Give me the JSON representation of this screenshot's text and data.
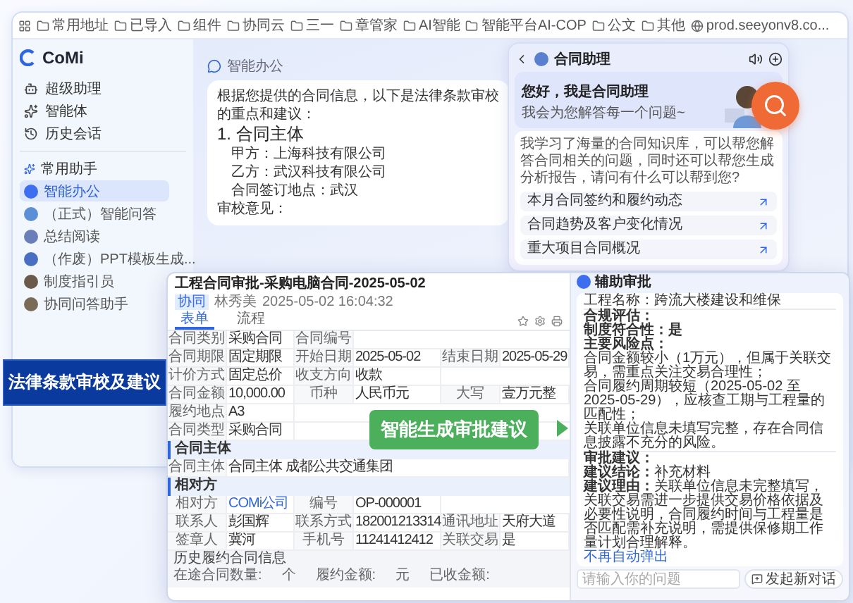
{
  "browser": {
    "bookmarks": [
      {
        "kind": "folder",
        "label": "常用地址"
      },
      {
        "kind": "folder",
        "label": "已导入"
      },
      {
        "kind": "folder",
        "label": "组件"
      },
      {
        "kind": "folder",
        "label": "协同云"
      },
      {
        "kind": "folder",
        "label": "三一"
      },
      {
        "kind": "folder",
        "label": "章管家"
      },
      {
        "kind": "folder",
        "label": "AI智能"
      },
      {
        "kind": "folder",
        "label": "智能平台AI-COP"
      },
      {
        "kind": "folder",
        "label": "公文"
      },
      {
        "kind": "folder",
        "label": "其他"
      },
      {
        "kind": "site",
        "label": "prod.seeyonv8.co..."
      }
    ]
  },
  "sidebar": {
    "logo": "CoMi",
    "nav": [
      {
        "kind": "assistant",
        "label": "超级助理"
      },
      {
        "kind": "agent",
        "label": "智能体"
      },
      {
        "kind": "history",
        "label": "历史会话"
      }
    ],
    "section": "常用助手",
    "assistants": [
      {
        "label": "智能办公",
        "selected": true,
        "color": "#3d6ef0"
      },
      {
        "label": "（正式）智能问答",
        "selected": false,
        "color": "#5b8fd6"
      },
      {
        "label": "总结阅读",
        "selected": false,
        "color": "#6a7fb8"
      },
      {
        "label": "（作废）PPT模板生成...",
        "selected": false,
        "color": "#4a6fc2"
      },
      {
        "label": "制度指引员",
        "selected": false,
        "color": "#6b5a4a"
      },
      {
        "label": "协同问答助手",
        "selected": false,
        "color": "#7a6a58"
      }
    ]
  },
  "chat": {
    "sender": "智能办公",
    "intro": "根据您提供的合同信息，以下是法律条款审校的重点和建议：",
    "heading": "1. 合同主体",
    "lines": [
      "甲方：上海科技有限公司",
      "乙方：武汉科技有限公司",
      "合同签订地点：武汉"
    ],
    "opinion": "审校意见："
  },
  "assistant_panel": {
    "title": "合同助理",
    "greeting": "您好，我是合同助理",
    "subtitle": "我会为您解答每一个问题~",
    "intro": "我学习了海量的合同知识库，可以帮您解答合同相关的问题，同时还可以帮您生成分析报告，请问有什么可以帮到您?",
    "suggestions": [
      "本月合同签约和履约动态",
      "合同趋势及客户变化情况",
      "重大项目合同概况"
    ]
  },
  "form": {
    "title": "工程合同审批-采购电脑合同-2025-05-02",
    "tag": "协同",
    "author": "林秀美",
    "time": "2025-05-02 16:04:32",
    "tabs": [
      {
        "label": "表单",
        "selected": true
      },
      {
        "label": "流程",
        "selected": false
      }
    ],
    "rows": [
      {
        "kind": "fields",
        "cells": [
          {
            "label": "合同类别",
            "value": "采购合同"
          },
          {
            "label": "合同编号"
          }
        ]
      },
      {
        "kind": "fields",
        "cells": [
          {
            "label": "合同期限",
            "value": "固定期限"
          },
          {
            "label": "开始日期",
            "value": "2025-05-02"
          },
          {
            "label": "结束日期",
            "value": "2025-05-29"
          }
        ]
      },
      {
        "kind": "fields",
        "cells": [
          {
            "label": "计价方式",
            "value": "固定总价"
          },
          {
            "label": "收支方向",
            "value": "收款"
          }
        ]
      },
      {
        "kind": "fields",
        "cells": [
          {
            "label": "合同金额",
            "value": "10,000.00"
          },
          {
            "label": "币种",
            "value": "人民币元"
          },
          {
            "label": "大写",
            "value": "壹万元整"
          }
        ]
      },
      {
        "kind": "fields",
        "cells": [
          {
            "label": "履约地点",
            "value": "A3"
          }
        ]
      },
      {
        "kind": "fields",
        "cells": [
          {
            "label": "合同类型",
            "value": "采购合同"
          }
        ]
      },
      {
        "kind": "section",
        "title": "合同主体"
      },
      {
        "kind": "fields",
        "cells": [
          {
            "label": "合同主体",
            "value": "合同主体  成都公共交通集团",
            "wide": true
          }
        ]
      },
      {
        "kind": "section",
        "title": "相对方"
      },
      {
        "kind": "fields",
        "cells": [
          {
            "label": "相对方",
            "value": "COMi公司",
            "link": true
          },
          {
            "label": "编号",
            "value": "OP-000001"
          }
        ]
      },
      {
        "kind": "fields",
        "cells": [
          {
            "label": "联系人",
            "value": "彭国辉"
          },
          {
            "label": "联系方式",
            "value": "182001213314"
          },
          {
            "label": "通讯地址",
            "value": "天府大道"
          }
        ]
      },
      {
        "kind": "fields",
        "cells": [
          {
            "label": "签章人",
            "value": "冀河"
          },
          {
            "label": "手机号",
            "value": "11241412412"
          },
          {
            "label": "关联交易",
            "value": "是"
          }
        ]
      },
      {
        "kind": "history",
        "title": "历史履约合同信息",
        "items": [
          "在途合同数量:",
          "个",
          "履约金额:",
          "元",
          "已收金额:"
        ]
      }
    ]
  },
  "review": {
    "title": "辅助审批",
    "sections": [
      [
        {
          "kind": "text",
          "text": "工程名称：跨流大楼建设和维保"
        }
      ],
      [
        {
          "kind": "heading",
          "text": "合规评估："
        },
        {
          "kind": "heading",
          "text": "制度符合性：是"
        },
        {
          "kind": "heading",
          "text": "主要风险点："
        },
        {
          "kind": "text",
          "text": "合同金额较小（1万元），但属于关联交易，需重点关注交易合理性；"
        },
        {
          "kind": "text",
          "text": "合同履约周期较短（2025-05-02 至 2025-05-29），应核查工期与工程量的匹配性；"
        },
        {
          "kind": "text",
          "text": "关联单位信息未填写完整，存在合同信息披露不充分的风险。"
        }
      ],
      [
        {
          "kind": "heading",
          "text": "审批建议："
        },
        {
          "kind": "text",
          "text": "**建议结论：**补充材料"
        },
        {
          "kind": "text",
          "text": "**建议理由：**关联单位信息未完整填写，关联交易需进一步提供交易价格依据及必要性说明，合同履约时间与工程量是否匹配需补充说明，需提供保修期工作量计划合理解释。"
        }
      ]
    ],
    "link": "不再自动弹出",
    "new_chat": "发起新对话",
    "input": {
      "placeholder": "请输入你的问题"
    }
  },
  "callouts": [
    {
      "kind": "blue",
      "text": "法律条款审校及建议"
    },
    {
      "kind": "green",
      "text": "智能生成审批建议"
    }
  ]
}
